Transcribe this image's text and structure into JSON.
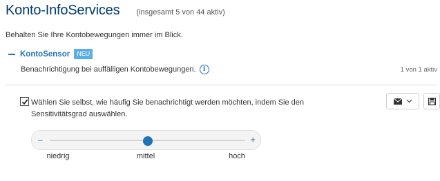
{
  "header": {
    "title": "Konto-InfoServices",
    "subtitle": "(insgesamt 5 von 44 aktiv)"
  },
  "intro": "Behalten Sie Ihre Kontobewegungen immer im Blick.",
  "section": {
    "title": "KontoSensor",
    "badge": "NEU",
    "description": "Benachrichtigung bei auffälligen Kontobewegungen.",
    "status": "1 von 1 aktiv"
  },
  "option": {
    "checked": true,
    "text": "Wählen Sie selbst, wie häufig Sie benachrichtigt werden möchten, indem Sie den Sensitivitätsgrad auswählen.",
    "channel_icon": "envelope-icon",
    "save_icon": "floppy-disk-icon"
  },
  "slider": {
    "minus": "–",
    "plus": "+",
    "labels": [
      "niedrig",
      "mittel",
      "hoch"
    ],
    "selected": "mittel",
    "value_fraction": 0.5
  },
  "colors": {
    "title": "#003a70",
    "accent": "#1f73b7",
    "badge": "#5aaee6"
  }
}
